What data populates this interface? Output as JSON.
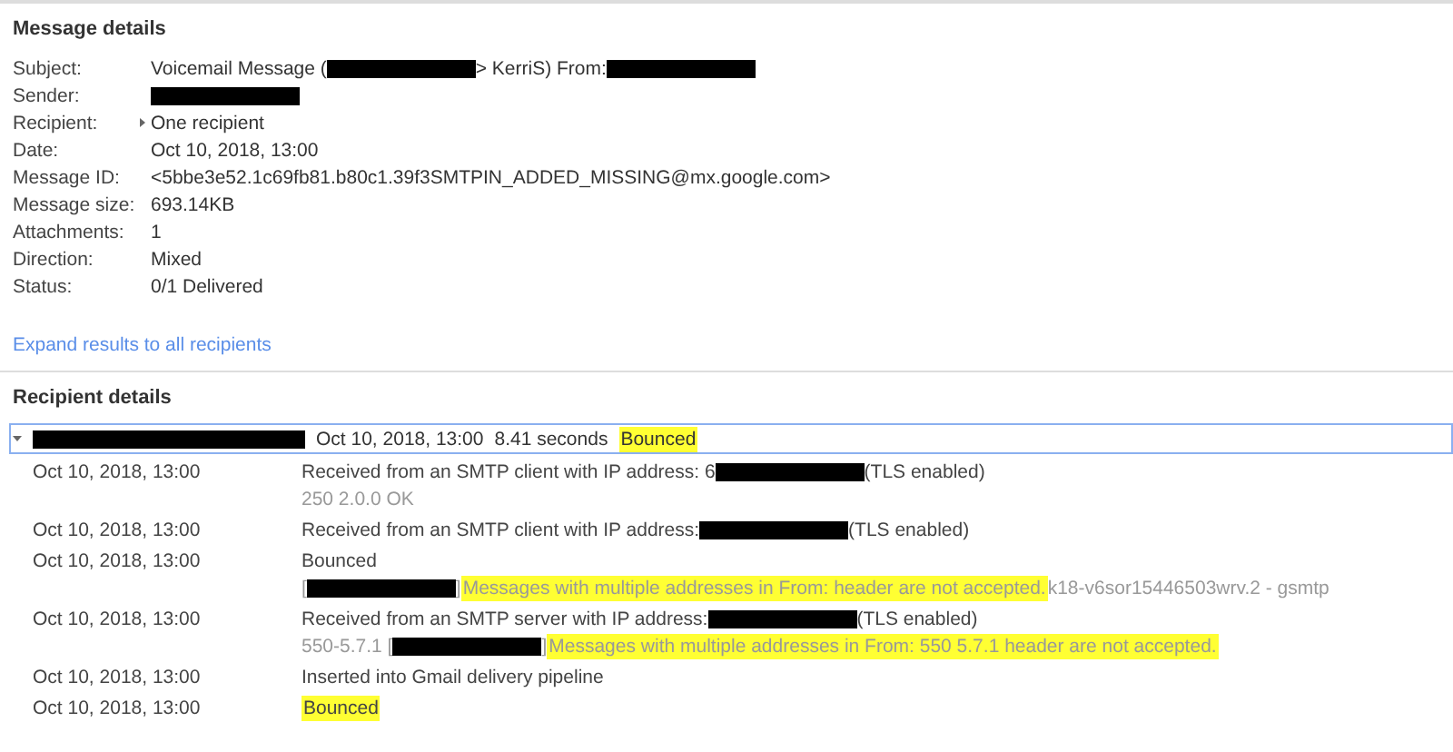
{
  "message_details": {
    "title": "Message details",
    "fields": [
      {
        "label": "Subject:",
        "parts": [
          {
            "kind": "text",
            "text": "Voicemail Message ("
          },
          {
            "kind": "redacted"
          },
          {
            "kind": "text",
            "text": "> KerriS) From:"
          },
          {
            "kind": "redacted"
          }
        ]
      },
      {
        "label": "Sender:",
        "parts": [
          {
            "kind": "redacted"
          }
        ]
      },
      {
        "label": "Recipient:",
        "expandable": true,
        "parts": [
          {
            "kind": "text",
            "text": "One recipient"
          }
        ]
      },
      {
        "label": "Date:",
        "parts": [
          {
            "kind": "text",
            "text": "Oct 10, 2018, 13:00"
          }
        ]
      },
      {
        "label": "Message ID:",
        "parts": [
          {
            "kind": "text",
            "text": "<5bbe3e52.1c69fb81.b80c1.39f3SMTPIN_ADDED_MISSING@mx.google.com>"
          }
        ]
      },
      {
        "label": "Message size:",
        "parts": [
          {
            "kind": "text",
            "text": "693.14KB"
          }
        ]
      },
      {
        "label": "Attachments:",
        "parts": [
          {
            "kind": "text",
            "text": "1"
          }
        ]
      },
      {
        "label": "Direction:",
        "parts": [
          {
            "kind": "text",
            "text": "Mixed"
          }
        ]
      },
      {
        "label": "Status:",
        "parts": [
          {
            "kind": "text",
            "text": "0/1 Delivered"
          }
        ]
      }
    ],
    "expand_link": "Expand results to all recipients"
  },
  "recipient_details": {
    "title": "Recipient details",
    "summary": {
      "expanded": true,
      "parts": [
        {
          "kind": "redacted"
        },
        {
          "kind": "text",
          "text": "Oct 10, 2018, 13:00"
        },
        {
          "kind": "text",
          "text": "8.41 seconds"
        },
        {
          "kind": "highlight",
          "text": "Bounced"
        }
      ]
    },
    "events": [
      {
        "time": "Oct 10, 2018, 13:00",
        "lines": [
          {
            "muted": false,
            "parts": [
              {
                "kind": "text",
                "text": "Received from an SMTP client with IP address: 6"
              },
              {
                "kind": "redacted"
              },
              {
                "kind": "text",
                "text": " (TLS enabled)"
              }
            ]
          },
          {
            "muted": true,
            "parts": [
              {
                "kind": "text",
                "text": "250 2.0.0 OK"
              }
            ]
          }
        ]
      },
      {
        "time": "Oct 10, 2018, 13:00",
        "lines": [
          {
            "muted": false,
            "parts": [
              {
                "kind": "text",
                "text": "Received from an SMTP client with IP address:"
              },
              {
                "kind": "redacted"
              },
              {
                "kind": "text",
                "text": " (TLS enabled)"
              }
            ]
          }
        ]
      },
      {
        "time": "Oct 10, 2018, 13:00",
        "lines": [
          {
            "muted": false,
            "parts": [
              {
                "kind": "text",
                "text": "Bounced"
              }
            ]
          },
          {
            "muted": true,
            "parts": [
              {
                "kind": "text",
                "text": "["
              },
              {
                "kind": "redacted"
              },
              {
                "kind": "text",
                "text": "]"
              },
              {
                "kind": "highlight",
                "text": "Messages with multiple addresses in From: header are not accepted."
              },
              {
                "kind": "text",
                "text": " k18-v6sor15446503wrv.2 - gsmtp"
              }
            ]
          }
        ]
      },
      {
        "time": "Oct 10, 2018, 13:00",
        "lines": [
          {
            "muted": false,
            "parts": [
              {
                "kind": "text",
                "text": "Received from an SMTP server with IP address: "
              },
              {
                "kind": "redacted"
              },
              {
                "kind": "text",
                "text": " (TLS enabled)"
              }
            ]
          },
          {
            "muted": true,
            "parts": [
              {
                "kind": "text",
                "text": "550-5.7.1 ["
              },
              {
                "kind": "redacted"
              },
              {
                "kind": "text",
                "text": "]"
              },
              {
                "kind": "highlight",
                "text": "Messages with multiple addresses in From: 550 5.7.1 header are not accepted."
              }
            ]
          }
        ]
      },
      {
        "time": "Oct 10, 2018, 13:00",
        "lines": [
          {
            "muted": false,
            "parts": [
              {
                "kind": "text",
                "text": "Inserted into Gmail delivery pipeline"
              }
            ]
          }
        ]
      },
      {
        "time": "Oct 10, 2018, 13:00",
        "lines": [
          {
            "muted": false,
            "parts": [
              {
                "kind": "highlight",
                "text": "Bounced"
              }
            ]
          }
        ]
      }
    ]
  }
}
